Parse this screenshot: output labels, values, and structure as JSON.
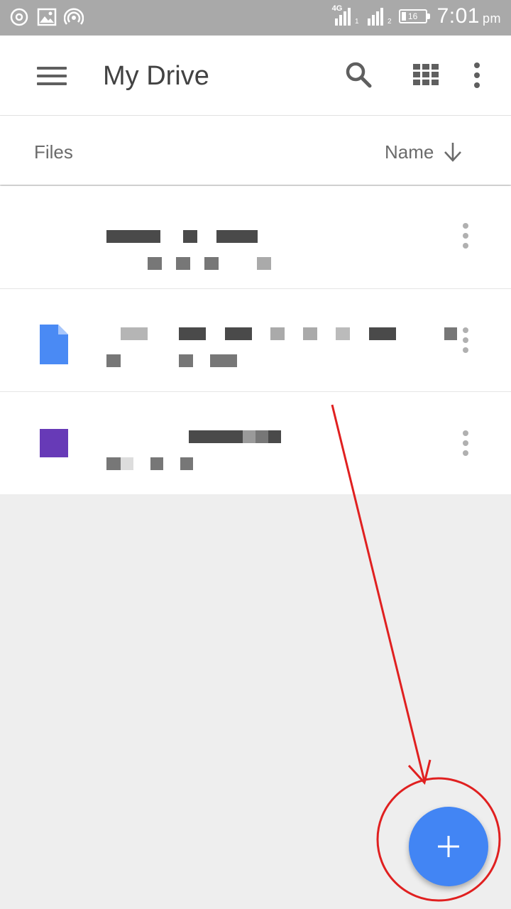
{
  "status_bar": {
    "network_label": "4G",
    "sim1_num": "1",
    "sim2_num": "2",
    "battery_level": "16",
    "time": "7:01",
    "ampm": "pm",
    "left_icons": [
      "data-saver-icon",
      "image-icon",
      "hotspot-icon"
    ]
  },
  "app_bar": {
    "title": "My Drive",
    "icons": [
      "menu-icon",
      "search-icon",
      "grid-view-icon",
      "more-vert-icon"
    ]
  },
  "sort_bar": {
    "section_label": "Files",
    "sort_label": "Name",
    "sort_direction_icon": "arrow-down-icon"
  },
  "files": [
    {
      "icon": "none",
      "title": "",
      "subtitle": ""
    },
    {
      "icon": "docs-file-icon",
      "icon_color": "#4a8af4",
      "title": "",
      "subtitle": ""
    },
    {
      "icon": "forms-file-icon",
      "icon_color": "#673ab7",
      "title": "",
      "subtitle": ""
    }
  ],
  "fab": {
    "icon": "plus-icon",
    "color": "#4285f4"
  },
  "annotation": {
    "color": "#e02020"
  }
}
